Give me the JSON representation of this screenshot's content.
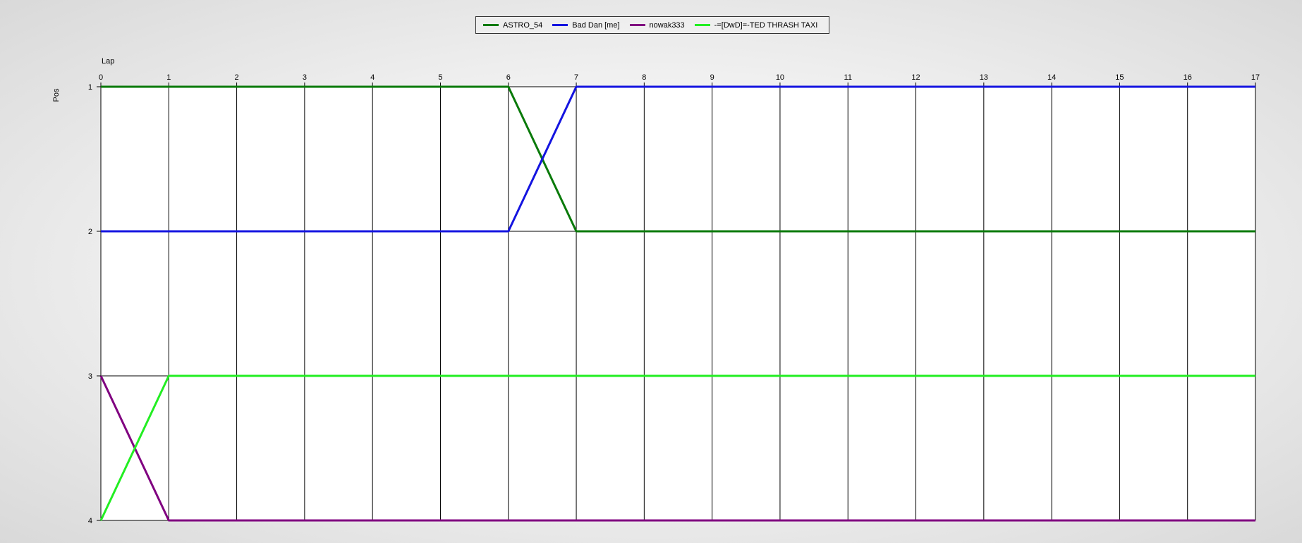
{
  "chart_data": {
    "type": "line",
    "title": "",
    "xlabel": "Lap",
    "ylabel": "Pos",
    "x": [
      0,
      1,
      2,
      3,
      4,
      5,
      6,
      7,
      8,
      9,
      10,
      11,
      12,
      13,
      14,
      15,
      16,
      17
    ],
    "xlim": [
      0,
      17
    ],
    "ylim": [
      1,
      4
    ],
    "y_inverted": true,
    "x_ticks": [
      "0",
      "1",
      "2",
      "3",
      "4",
      "5",
      "6",
      "7",
      "8",
      "9",
      "10",
      "11",
      "12",
      "13",
      "14",
      "15",
      "16",
      "17"
    ],
    "y_ticks": [
      "1",
      "2",
      "3",
      "4"
    ],
    "grid": true,
    "legend_position": "top-center",
    "series": [
      {
        "name": "ASTRO_54",
        "color": "#0a7a0a",
        "values": [
          1,
          1,
          1,
          1,
          1,
          1,
          1,
          2,
          2,
          2,
          2,
          2,
          2,
          2,
          2,
          2,
          2,
          2
        ]
      },
      {
        "name": "Bad Dan [me]",
        "color": "#1414e0",
        "values": [
          2,
          2,
          2,
          2,
          2,
          2,
          2,
          1,
          1,
          1,
          1,
          1,
          1,
          1,
          1,
          1,
          1,
          1
        ]
      },
      {
        "name": "nowak333",
        "color": "#800080",
        "values": [
          3,
          4,
          4,
          4,
          4,
          4,
          4,
          4,
          4,
          4,
          4,
          4,
          4,
          4,
          4,
          4,
          4,
          4
        ]
      },
      {
        "name": "-=[DwD]=-TED THRASH TAXI",
        "color": "#22ee22",
        "values": [
          4,
          3,
          3,
          3,
          3,
          3,
          3,
          3,
          3,
          3,
          3,
          3,
          3,
          3,
          3,
          3,
          3,
          3
        ]
      }
    ]
  }
}
